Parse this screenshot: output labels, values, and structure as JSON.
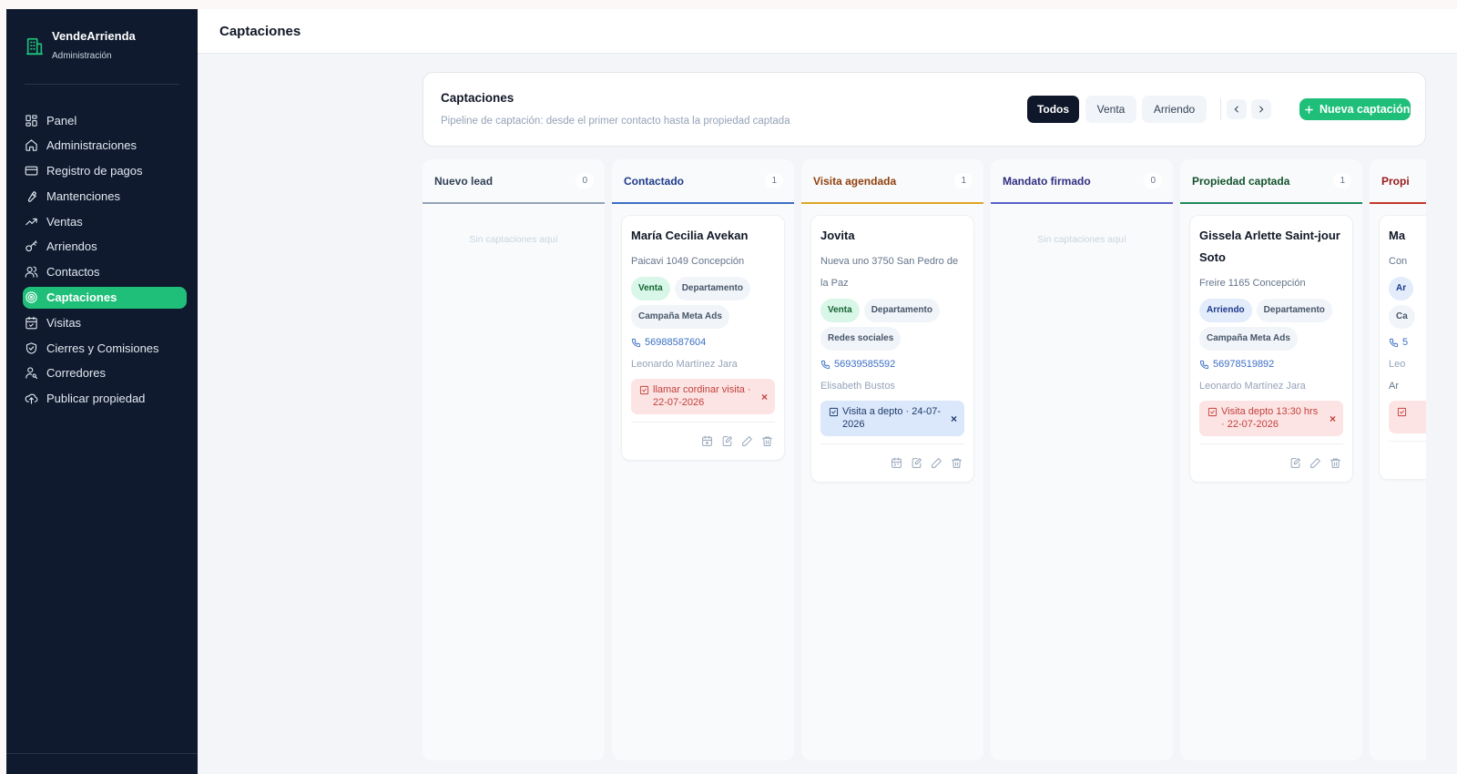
{
  "app": {
    "brand": "VendeArrienda",
    "brand_sub": "Administración",
    "page_title": "Captaciones"
  },
  "sidebar": {
    "items": [
      {
        "label": "Panel",
        "icon": "grid-icon",
        "active": false
      },
      {
        "label": "Administraciones",
        "icon": "home-icon",
        "active": false
      },
      {
        "label": "Registro de pagos",
        "icon": "credit-card-icon",
        "active": false
      },
      {
        "label": "Mantenciones",
        "icon": "wrench-icon",
        "active": false
      },
      {
        "label": "Ventas",
        "icon": "trending-up-icon",
        "active": false
      },
      {
        "label": "Arriendos",
        "icon": "key-icon",
        "active": false
      },
      {
        "label": "Contactos",
        "icon": "users-icon",
        "active": false
      },
      {
        "label": "Captaciones",
        "icon": "target-icon",
        "active": true
      },
      {
        "label": "Visitas",
        "icon": "calendar-check-icon",
        "active": false
      },
      {
        "label": "Cierres y Comisiones",
        "icon": "handshake-icon",
        "active": false
      },
      {
        "label": "Corredores",
        "icon": "user-key-icon",
        "active": false
      },
      {
        "label": "Publicar propiedad",
        "icon": "cloud-upload-icon",
        "active": false
      }
    ]
  },
  "header": {
    "title": "Captaciones",
    "subtitle": "Pipeline de captación: desde el primer contacto hasta la propiedad captada",
    "filters": [
      "Todos",
      "Venta",
      "Arriendo"
    ],
    "active_filter": "Todos",
    "new_button": "Nueva captación"
  },
  "columns": [
    {
      "title": "Nuevo lead",
      "count": "0",
      "color": "#94a3b8",
      "text_color": "#334155",
      "empty": "Sin captaciones aquí"
    },
    {
      "title": "Contactado",
      "count": "1",
      "color": "#3b6fc4",
      "text_color": "#1e3a8a"
    },
    {
      "title": "Visita agendada",
      "count": "1",
      "color": "#e0a526",
      "text_color": "#92400e"
    },
    {
      "title": "Mandato firmado",
      "count": "0",
      "color": "#5b5fc7",
      "text_color": "#312e81",
      "empty": "Sin captaciones aquí"
    },
    {
      "title": "Propiedad captada",
      "count": "1",
      "color": "#1f8a5b",
      "text_color": "#14532d"
    },
    {
      "title": "Propi",
      "count": "",
      "color": "#c0392b",
      "text_color": "#991b1b"
    }
  ],
  "cards": [
    {
      "name": "María Cecilia Avekan",
      "address": "Paicavi 1049 Concepción",
      "tags": [
        "Venta",
        "Departamento",
        "Campaña Meta Ads"
      ],
      "phone": "56988587604",
      "agent": "Leonardo Martínez Jara",
      "task": "llamar cordinar visita · 22-07-2026",
      "task_style": "red",
      "close": "×"
    },
    {
      "name": "Jovita",
      "address": "Nueva uno 3750 San Pedro de la Paz",
      "tags": [
        "Venta",
        "Departamento",
        "Redes sociales"
      ],
      "phone": "56939585592",
      "agent": "Elisabeth Bustos",
      "task": "Visita a depto · 24-07-2026",
      "task_style": "blue",
      "close": "×"
    },
    {
      "name": "Gissela Arlette Saint-jour Soto",
      "address": "Freire 1165 Concepción",
      "tags": [
        "Arriendo",
        "Departamento",
        "Campaña Meta Ads"
      ],
      "phone": "56978519892",
      "agent": "Leonardo Martínez Jara",
      "task": "Visita depto 13:30 hrs · 22-07-2026",
      "task_style": "red",
      "close": "×"
    },
    {
      "name": "Ma",
      "address": "Con",
      "tags": [
        "Ar",
        "Ca"
      ],
      "phone": "5",
      "agent": "Leo",
      "task": "Ar",
      "task_style": "red",
      "close": ""
    }
  ]
}
